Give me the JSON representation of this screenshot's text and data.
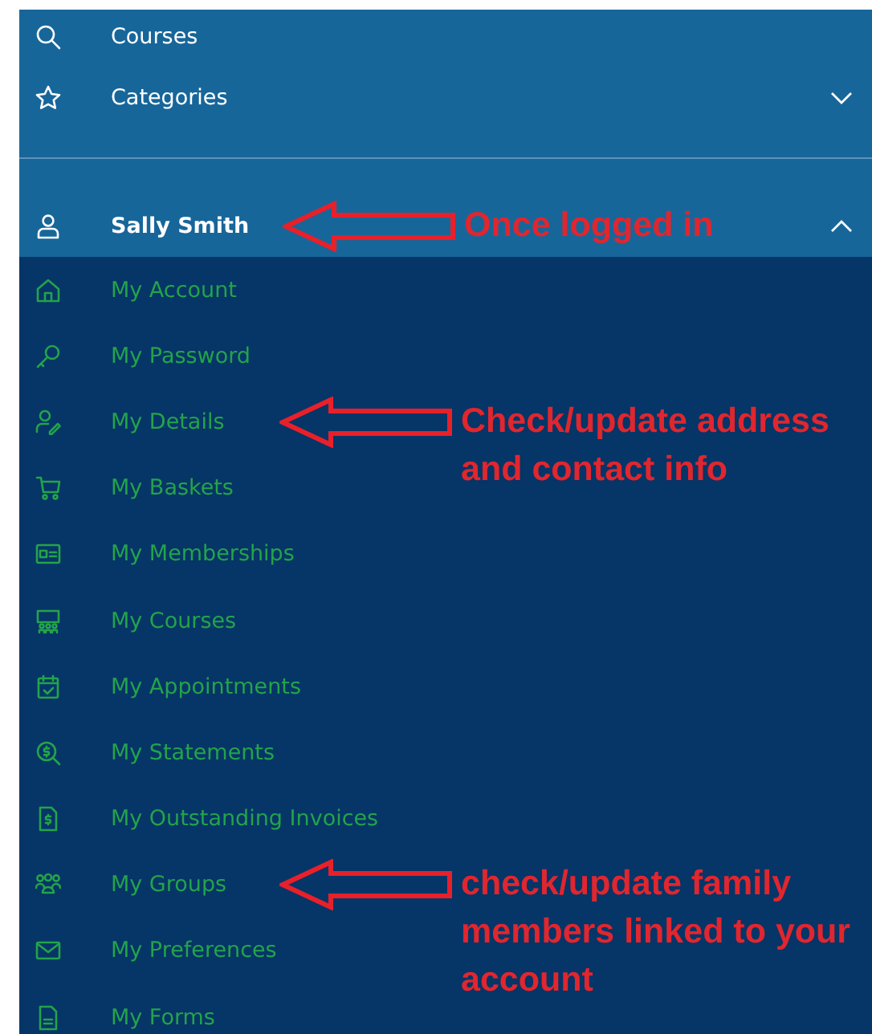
{
  "nav": {
    "items": [
      {
        "label": "Courses",
        "kind": "search"
      },
      {
        "label": "Categories",
        "kind": "star",
        "expanded": false
      }
    ]
  },
  "user_menu": {
    "label": "Sally Smith",
    "kind": "user",
    "expanded": true,
    "note": "Once logged in",
    "items": [
      {
        "label": "My Account",
        "kind": "home"
      },
      {
        "label": "My Password",
        "kind": "key"
      },
      {
        "label": "My Details",
        "kind": "user-edit",
        "note": "Check/update address and contact info"
      },
      {
        "label": "My Baskets",
        "kind": "cart"
      },
      {
        "label": "My Memberships",
        "kind": "card"
      },
      {
        "label": "My Courses",
        "kind": "classroom"
      },
      {
        "label": "My Appointments",
        "kind": "calendar"
      },
      {
        "label": "My Statements",
        "kind": "zoom-dollar"
      },
      {
        "label": "My Outstanding Invoices",
        "kind": "invoice"
      },
      {
        "label": "My Groups",
        "kind": "group",
        "note": "check/update family members linked to your account"
      },
      {
        "label": "My Preferences",
        "kind": "mail"
      },
      {
        "label": "My Forms",
        "kind": "form"
      }
    ]
  }
}
